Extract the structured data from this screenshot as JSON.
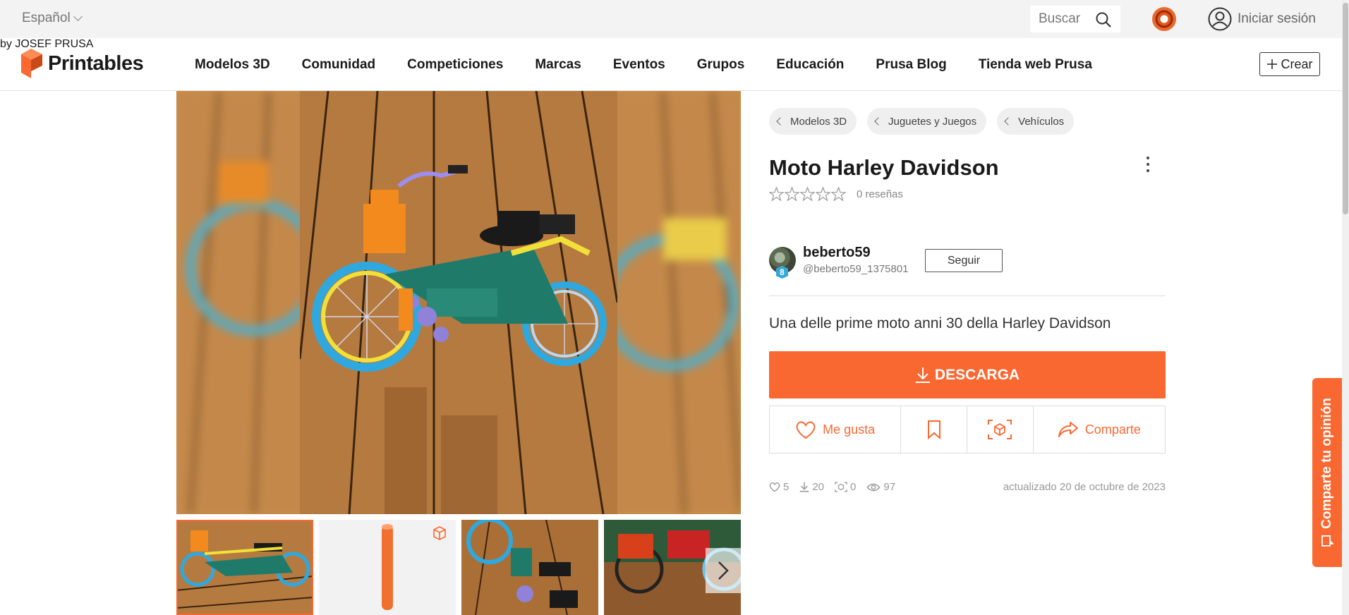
{
  "topbar": {
    "language": "Español",
    "search_placeholder": "Buscar",
    "login": "Iniciar sesión"
  },
  "brand": {
    "name": "Printables",
    "tagline": "by JOSEF PRUSA",
    "accent": "#fa6831"
  },
  "nav": {
    "items": [
      "Modelos 3D",
      "Comunidad",
      "Competiciones",
      "Marcas",
      "Eventos",
      "Grupos",
      "Educación",
      "Prusa Blog",
      "Tienda web Prusa"
    ],
    "create": "Crear"
  },
  "model": {
    "breadcrumbs": [
      "Modelos 3D",
      "Juguetes y Juegos",
      "Vehículos"
    ],
    "title": "Moto Harley Davidson",
    "rating_stars": 0,
    "reviews": "0 reseñas",
    "author": {
      "name": "beberto59",
      "handle": "@beberto59_1375801",
      "level": "8",
      "follow": "Seguir"
    },
    "description": "Una delle prime moto anni 30 della Harley Davidson",
    "download": "DESCARGA",
    "actions": {
      "like": "Me gusta",
      "share": "Comparte"
    },
    "stats": {
      "likes": "5",
      "downloads": "20",
      "makes": "0",
      "views": "97"
    },
    "updated": "actualizado 20 de octubre de 2023"
  },
  "gallery": {
    "thumbnail_count": 4
  },
  "feedback": {
    "label": "Comparte tu opinión"
  }
}
